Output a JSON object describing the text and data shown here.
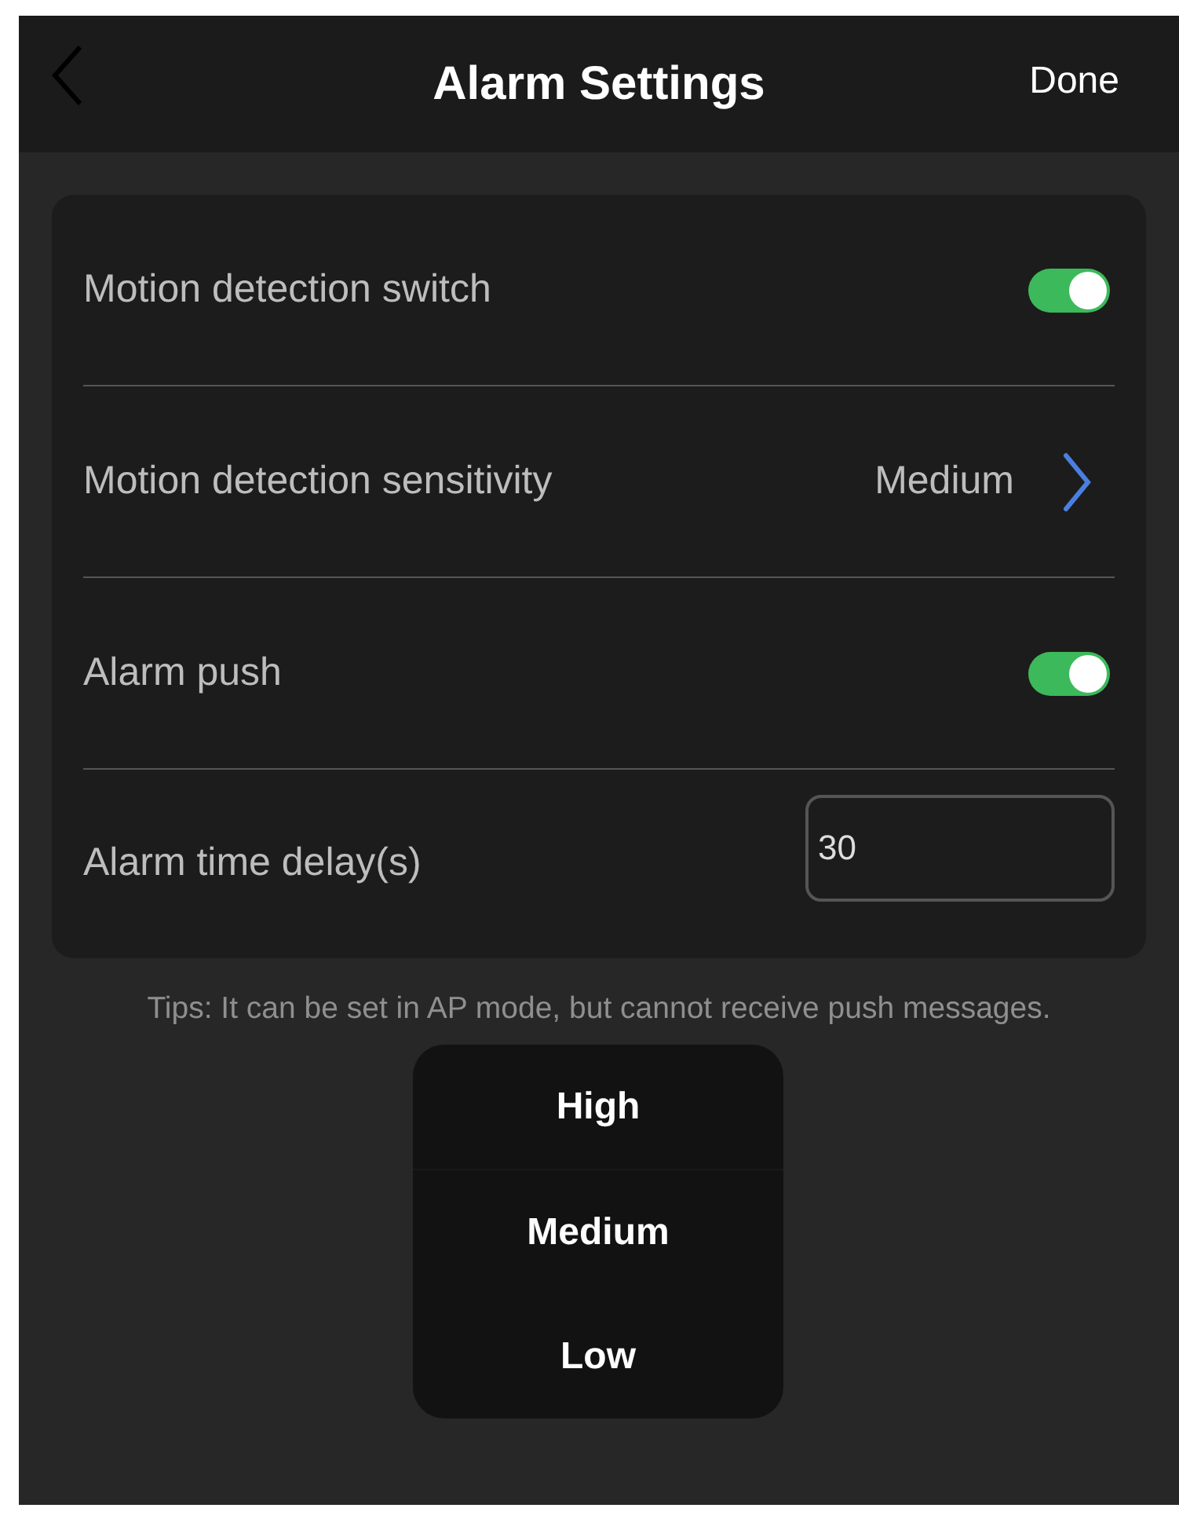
{
  "header": {
    "title": "Alarm Settings",
    "done": "Done"
  },
  "settings": [
    {
      "kind": "toggle",
      "label": "Motion detection switch",
      "on": true
    },
    {
      "kind": "select",
      "label": "Motion detection sensitivity",
      "value": "Medium"
    },
    {
      "kind": "toggle",
      "label": "Alarm push",
      "on": true
    },
    {
      "kind": "input",
      "label": "Alarm time delay(s)",
      "value": "30"
    }
  ],
  "tips": "Tips: It can be set in AP mode, but cannot receive push messages.",
  "picker": {
    "options": [
      "High",
      "Medium",
      "Low"
    ]
  }
}
